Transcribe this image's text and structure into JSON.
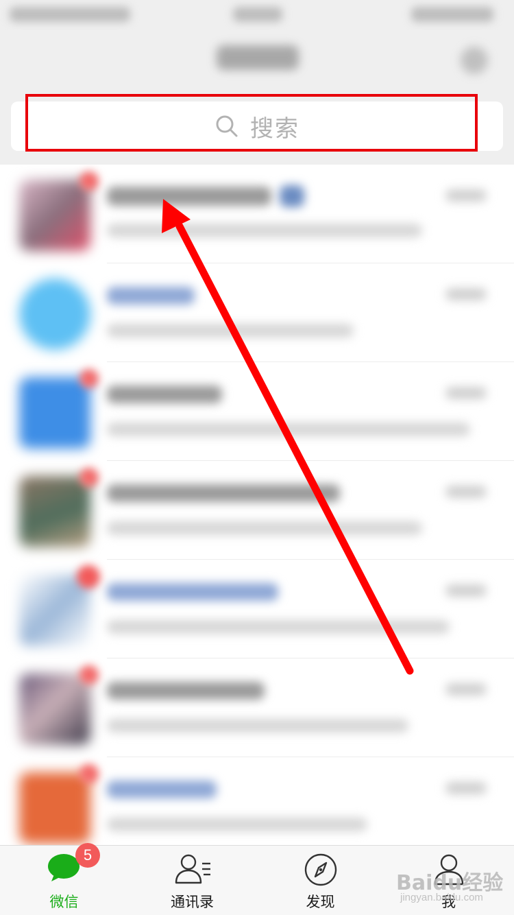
{
  "search": {
    "placeholder": "搜索",
    "highlight_color": "#e8000b"
  },
  "annotation": {
    "arrow_color": "#ff0000"
  },
  "chat_list": {
    "row_count": 7,
    "content_blurred": true
  },
  "tab_bar": {
    "active_color": "#1aad19",
    "tabs": [
      {
        "label": "微信",
        "icon": "chat-bubble-icon",
        "badge": "5",
        "active": true
      },
      {
        "label": "通讯录",
        "icon": "contacts-icon",
        "active": false
      },
      {
        "label": "发现",
        "icon": "compass-icon",
        "active": false
      },
      {
        "label": "我",
        "icon": "person-icon",
        "active": false
      }
    ]
  },
  "watermark": {
    "logo_text": "Baidu经验",
    "url": "jingyan.baidu.com"
  }
}
